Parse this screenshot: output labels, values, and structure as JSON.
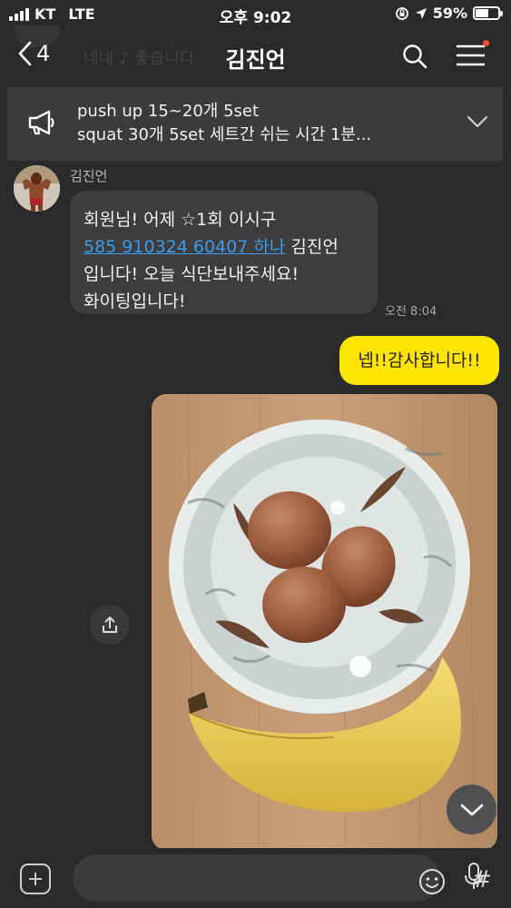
{
  "status_bar": {
    "carrier": "KT",
    "network": "LTE",
    "time": "오후 9:02",
    "battery": "59%",
    "battery_level": 0.59
  },
  "header": {
    "back_count": "4",
    "title": "김진언",
    "ghost_text": "네네 ♪ 좋습니다"
  },
  "notice": {
    "line1": "push up 15~20개 5set",
    "line2": "squat 30개 5set 세트간 쉬는 시간 1분..."
  },
  "messages": {
    "sender_name": "김진언",
    "incoming": {
      "line1": "회원님! 어제 ☆1회 이시구",
      "link": "585 910324 60407 하나",
      "line2_rest": " 김진언",
      "line3": "입니다!  오늘 식단보내주세요!",
      "line4": "화이팅입니다!",
      "time": "오전 8:04"
    },
    "outgoing": {
      "text": "넵!!감사합니다!!"
    }
  },
  "input": {
    "placeholder": "",
    "hash_symbol": "#"
  },
  "colors": {
    "background": "#2a2a2c",
    "outgoing_bubble": "#fde500",
    "incoming_bubble": "#3d3d3f",
    "link": "#3d9be9"
  }
}
